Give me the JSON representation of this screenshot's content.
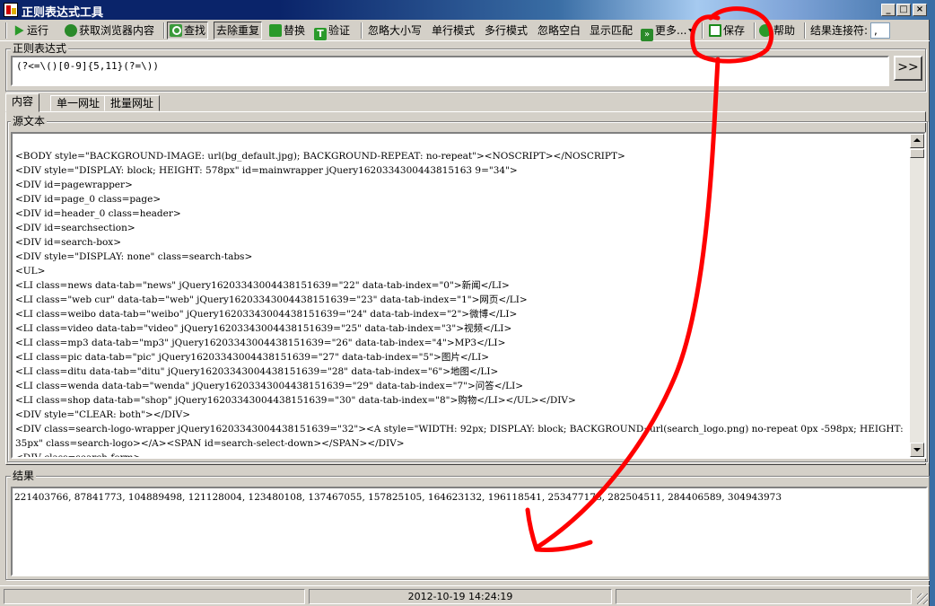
{
  "window": {
    "title": "正则表达式工具",
    "minimize_glyph": "_",
    "maximize_glyph": "□",
    "close_glyph": "×"
  },
  "toolbar": {
    "run": "运行",
    "get_browser": "获取浏览器内容",
    "find": "查找",
    "clear_repeat": "去除重复",
    "replace": "替换",
    "verify": "验证",
    "ignore_case": "忽略大小写",
    "single_line": "单行模式",
    "multi_line": "多行模式",
    "ignore_space": "忽略空白",
    "show_match": "显示匹配",
    "more": "更多...",
    "save": "保存",
    "help": "帮助",
    "separator_label": "结果连接符:",
    "separator_value": ","
  },
  "regex": {
    "label": "正则表达式",
    "value": "(?<=\\()[0-9]{5,11}(?=\\))",
    "go_button": ">>"
  },
  "tabs": [
    {
      "label": "内容",
      "active": true
    },
    {
      "label": "单一网址",
      "active": false
    },
    {
      "label": "批量网址",
      "active": false
    }
  ],
  "source": {
    "label": "源文本",
    "text": "<BODY style=\"BACKGROUND-IMAGE: url(bg_default.jpg); BACKGROUND-REPEAT: no-repeat\"><NOSCRIPT></NOSCRIPT>\n<DIV style=\"DISPLAY: block; HEIGHT: 578px\" id=mainwrapper jQuery1620334300443815163 9=\"34\">\n<DIV id=pagewrapper>\n<DIV id=page_0 class=page>\n<DIV id=header_0 class=header>\n<DIV id=searchsection>\n<DIV id=search-box>\n<DIV style=\"DISPLAY: none\" class=search-tabs>\n<UL>\n<LI class=news data-tab=\"news\" jQuery16203343004438151639=\"22\" data-tab-index=\"0\">新闻</LI>\n<LI class=\"web cur\" data-tab=\"web\" jQuery16203343004438151639=\"23\" data-tab-index=\"1\">网页</LI>\n<LI class=weibo data-tab=\"weibo\" jQuery16203343004438151639=\"24\" data-tab-index=\"2\">微博</LI>\n<LI class=video data-tab=\"video\" jQuery16203343004438151639=\"25\" data-tab-index=\"3\">视频</LI>\n<LI class=mp3 data-tab=\"mp3\" jQuery16203343004438151639=\"26\" data-tab-index=\"4\">MP3</LI>\n<LI class=pic data-tab=\"pic\" jQuery16203343004438151639=\"27\" data-tab-index=\"5\">图片</LI>\n<LI class=ditu data-tab=\"ditu\" jQuery16203343004438151639=\"28\" data-tab-index=\"6\">地图</LI>\n<LI class=wenda data-tab=\"wenda\" jQuery16203343004438151639=\"29\" data-tab-index=\"7\">问答</LI>\n<LI class=shop data-tab=\"shop\" jQuery16203343004438151639=\"30\" data-tab-index=\"8\">购物</LI></UL></DIV>\n<DIV style=\"CLEAR: both\"></DIV>\n<DIV class=search-logo-wrapper jQuery16203343004438151639=\"32\"><A style=\"WIDTH: 92px; DISPLAY: block; BACKGROUND: url(search_logo.png) no-repeat 0px -598px; HEIGHT: 35px\" class=search-logo></A><SPAN id=search-select-down></SPAN></DIV>\n<DIV class=search-form>"
  },
  "result": {
    "label": "结果",
    "text": "221403766, 87841773, 104889498, 121128004, 123480108, 137467055, 157825105, 164623132, 196118541, 253477178, 282504511, 284406589, 304943973"
  },
  "status": {
    "datetime": "2012-10-19 14:24:19"
  },
  "colors": {
    "annotation": "#ff0000",
    "title_bar": "#0a246a",
    "face": "#d4d0c8"
  }
}
